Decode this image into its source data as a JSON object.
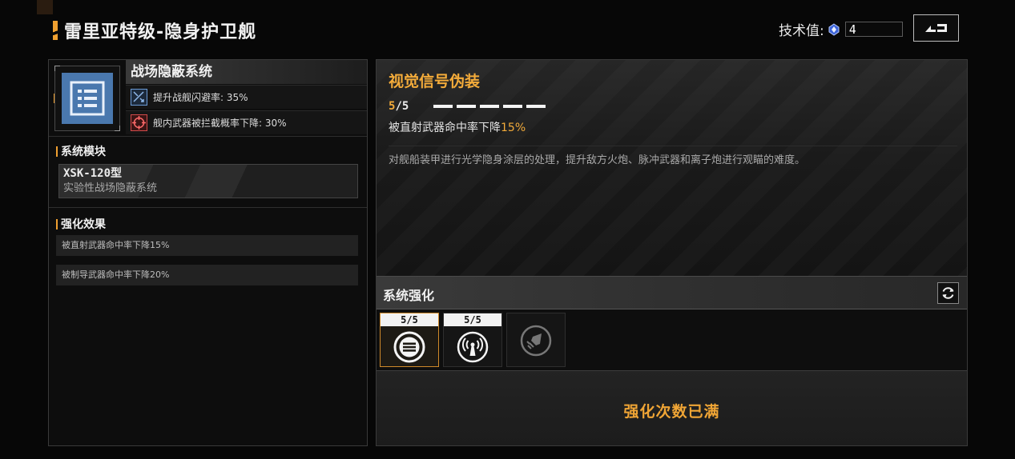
{
  "header": {
    "title": "雷里亚特级-隐身护卫舰",
    "tech_label": "技术值:",
    "tech_value": "4",
    "tech_icon": "tech-crystal-icon",
    "back_icon": "back-arrow-icon"
  },
  "system": {
    "name": "战场隐蔽系统",
    "icon": "list-icon",
    "stats": [
      {
        "icon": "evasion-icon",
        "text": "提升战舰闪避率: 35%"
      },
      {
        "icon": "target-icon",
        "text": "舰内武器被拦截概率下降: 30%"
      }
    ]
  },
  "module": {
    "section_label": "系统模块",
    "code": "XSK-120型",
    "desc": "实验性战场隐蔽系统"
  },
  "effects": {
    "section_label": "强化效果",
    "items": [
      "被直射武器命中率下降15%",
      "被制导武器命中率下降20%"
    ]
  },
  "detail": {
    "title": "视觉信号伪装",
    "level_current": "5",
    "level_max": "/5",
    "level_filled": 5,
    "line_prefix": "被直射武器命中率下降",
    "line_value": "15%",
    "description": "对舰船装甲进行光学隐身涂层的处理，提升敌方火炮、脉冲武器和离子炮进行观瞄的难度。"
  },
  "enhance": {
    "title": "系统强化",
    "refresh_icon": "refresh-icon",
    "slots": [
      {
        "count": "5/5",
        "icon": "disc-icon",
        "selected": true,
        "locked": false
      },
      {
        "count": "5/5",
        "icon": "signal-icon",
        "selected": false,
        "locked": false
      },
      {
        "count": "",
        "icon": "missile-icon",
        "selected": false,
        "locked": true
      }
    ],
    "max_text": "强化次数已满"
  },
  "colors": {
    "accent": "#f0a030",
    "highlight": "#f3ab3a",
    "system_icon_bg": "#4a78ae"
  }
}
